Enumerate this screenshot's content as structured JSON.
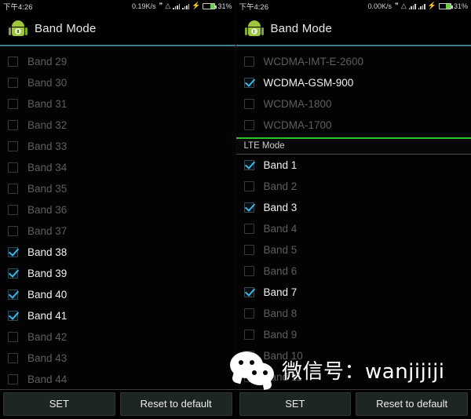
{
  "panels": [
    {
      "id": "left",
      "statusbar": {
        "clock": "下午4:26",
        "data_rate": "0.19K/s",
        "bluetooth_icon": "bluetooth-icon",
        "wifi_icon": "wifi-icon",
        "signal_icon_1": "signal-bars-icon",
        "signal_icon_2": "signal-bars-icon",
        "charging_icon": "charging-bolt-icon",
        "battery_icon": "battery-icon",
        "battery_percent": "31%"
      },
      "title": "Band Mode",
      "app_icon": "android-robot-icon",
      "items": [
        {
          "label": "Band 29",
          "checked": false
        },
        {
          "label": "Band 30",
          "checked": false
        },
        {
          "label": "Band 31",
          "checked": false
        },
        {
          "label": "Band 32",
          "checked": false
        },
        {
          "label": "Band 33",
          "checked": false
        },
        {
          "label": "Band 34",
          "checked": false
        },
        {
          "label": "Band 35",
          "checked": false
        },
        {
          "label": "Band 36",
          "checked": false
        },
        {
          "label": "Band 37",
          "checked": false
        },
        {
          "label": "Band 38",
          "checked": true
        },
        {
          "label": "Band 39",
          "checked": true
        },
        {
          "label": "Band 40",
          "checked": true
        },
        {
          "label": "Band 41",
          "checked": true
        },
        {
          "label": "Band 42",
          "checked": false
        },
        {
          "label": "Band 43",
          "checked": false
        },
        {
          "label": "Band 44",
          "checked": false
        }
      ],
      "buttons": {
        "set": "SET",
        "reset": "Reset to default"
      }
    },
    {
      "id": "right",
      "statusbar": {
        "clock": "下午4:26",
        "data_rate": "0.00K/s",
        "bluetooth_icon": "bluetooth-icon",
        "wifi_icon": "wifi-icon",
        "signal_icon_1": "signal-bars-icon",
        "signal_icon_2": "signal-bars-icon",
        "charging_icon": "charging-bolt-icon",
        "battery_icon": "battery-icon",
        "battery_percent": "31%"
      },
      "title": "Band Mode",
      "app_icon": "android-robot-icon",
      "items_top": [
        {
          "label": "WCDMA-IMT-E-2600",
          "checked": false
        },
        {
          "label": "WCDMA-GSM-900",
          "checked": true
        },
        {
          "label": "WCDMA-1800",
          "checked": false
        },
        {
          "label": "WCDMA-1700",
          "checked": false
        }
      ],
      "section_header": "LTE Mode",
      "items_lte": [
        {
          "label": "Band 1",
          "checked": true
        },
        {
          "label": "Band 2",
          "checked": false
        },
        {
          "label": "Band 3",
          "checked": true
        },
        {
          "label": "Band 4",
          "checked": false
        },
        {
          "label": "Band 5",
          "checked": false
        },
        {
          "label": "Band 6",
          "checked": false
        },
        {
          "label": "Band 7",
          "checked": true
        },
        {
          "label": "Band 8",
          "checked": false
        },
        {
          "label": "Band 9",
          "checked": false
        },
        {
          "label": "Band 10",
          "checked": false
        },
        {
          "label": "Band 11",
          "checked": false
        }
      ],
      "buttons": {
        "set": "SET",
        "reset": "Reset to default"
      }
    }
  ],
  "watermark": {
    "logo": "wechat-logo-icon",
    "text": "微信号：wanjijiji"
  },
  "colors": {
    "accent_check": "#3ab6e8",
    "title_underline": "#3f7d8c",
    "section_divider": "#2fc22f",
    "battery_green": "#6dd04a",
    "android_green": "#9ec63b"
  }
}
